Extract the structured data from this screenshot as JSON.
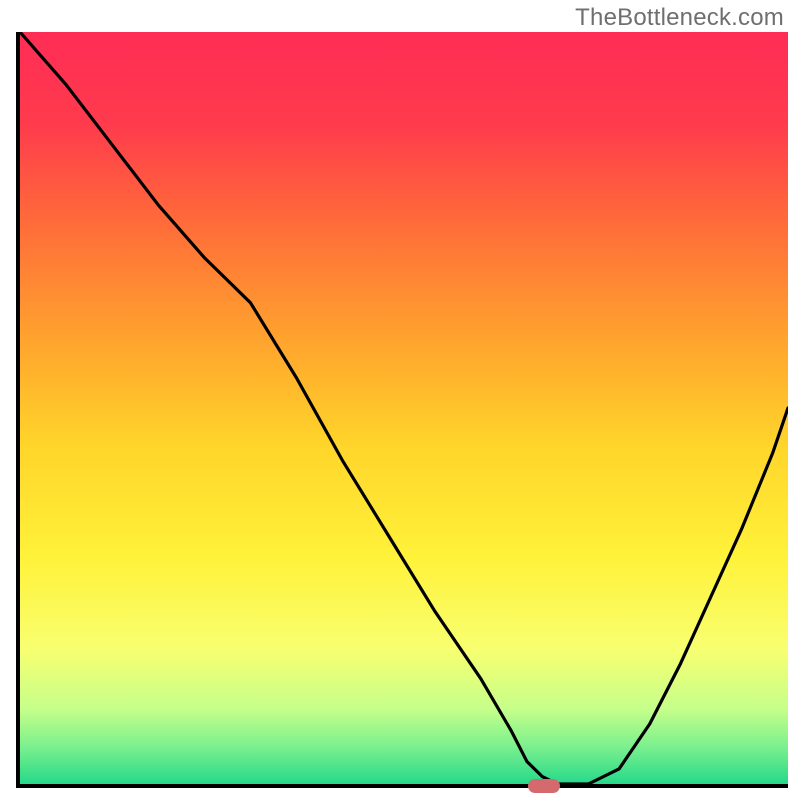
{
  "watermark": "TheBottleneck.com",
  "colors": {
    "stroke": "#000000",
    "marker": "#d46a6e",
    "gradient_stops": [
      {
        "offset": 0.0,
        "color": "#ff2d55"
      },
      {
        "offset": 0.12,
        "color": "#ff3a4d"
      },
      {
        "offset": 0.25,
        "color": "#ff6a3a"
      },
      {
        "offset": 0.4,
        "color": "#ffa02e"
      },
      {
        "offset": 0.55,
        "color": "#ffd52a"
      },
      {
        "offset": 0.7,
        "color": "#fff23a"
      },
      {
        "offset": 0.82,
        "color": "#f8ff70"
      },
      {
        "offset": 0.9,
        "color": "#c6ff8a"
      },
      {
        "offset": 0.95,
        "color": "#7cf08e"
      },
      {
        "offset": 1.0,
        "color": "#25d98a"
      }
    ]
  },
  "chart_data": {
    "type": "line",
    "title": "",
    "xlabel": "",
    "ylabel": "",
    "xlim": [
      0,
      100
    ],
    "ylim": [
      0,
      100
    ],
    "x": [
      0,
      6,
      12,
      18,
      24,
      30,
      36,
      42,
      48,
      54,
      60,
      64,
      66,
      68,
      70,
      74,
      78,
      82,
      86,
      90,
      94,
      98,
      100
    ],
    "y": [
      100,
      93,
      85,
      77,
      70,
      64,
      54,
      43,
      33,
      23,
      14,
      7,
      3,
      1,
      0,
      0,
      2,
      8,
      16,
      25,
      34,
      44,
      50
    ],
    "marker": {
      "x": 68,
      "y": 0
    },
    "gradient_direction": "vertical_top_red_bottom_green"
  }
}
